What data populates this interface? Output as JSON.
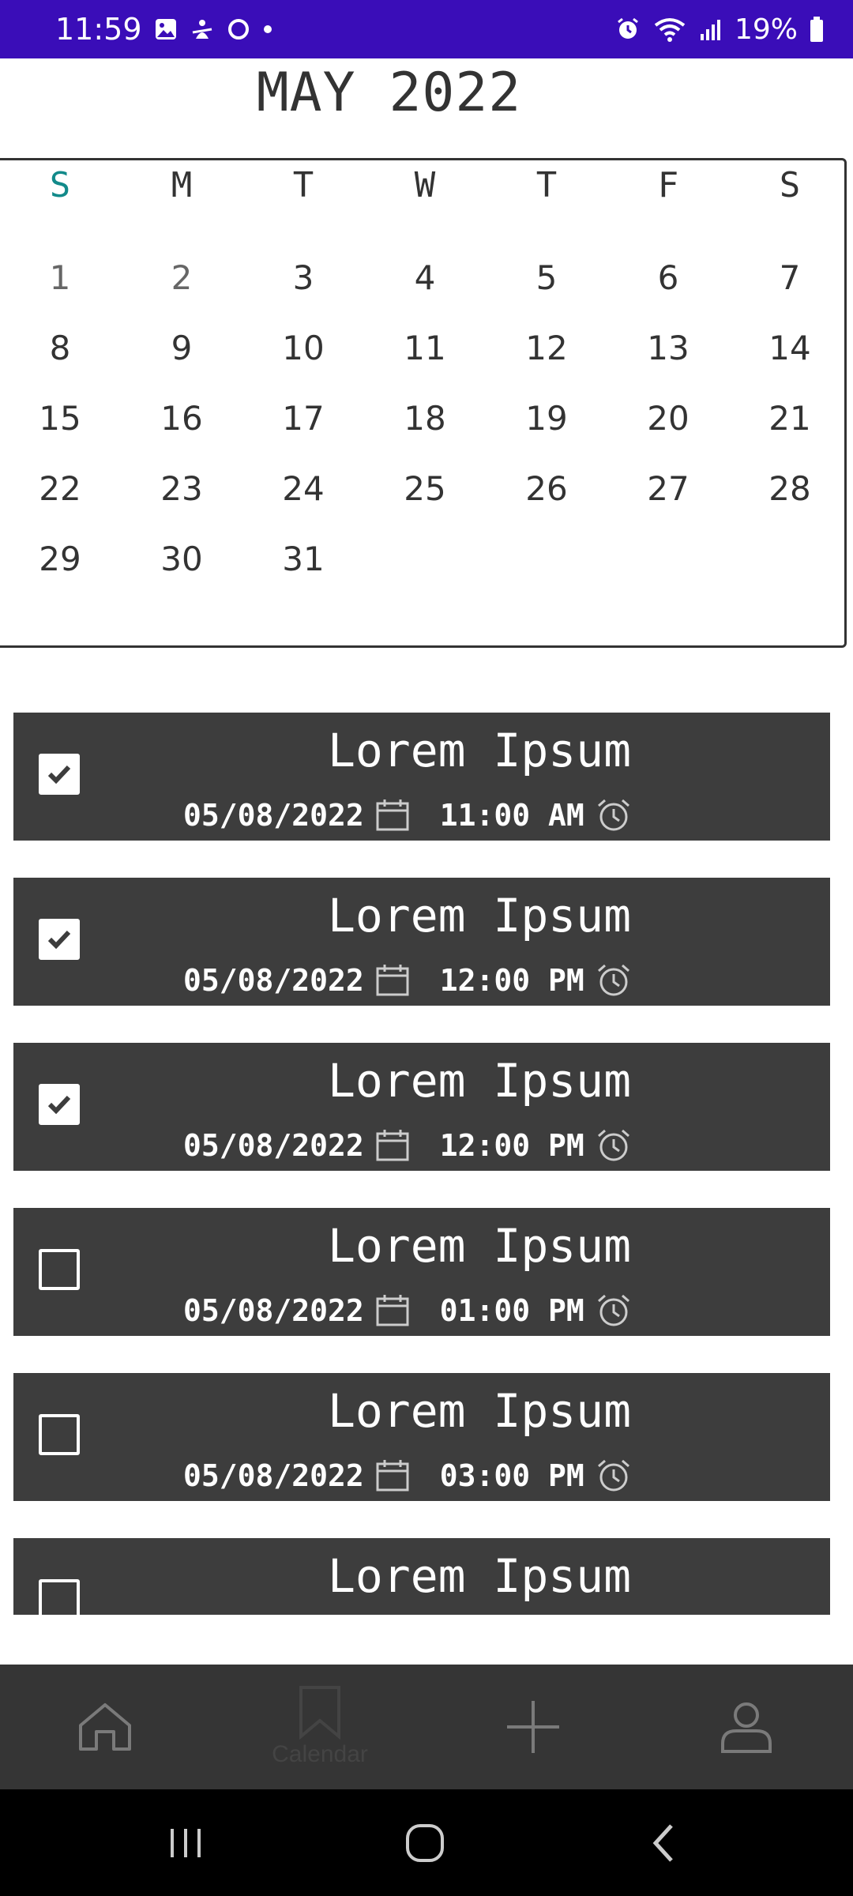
{
  "status_bar": {
    "time": "11:59",
    "battery": "19%",
    "background_color": "#3a0db8"
  },
  "calendar": {
    "month_title": "MAY 2022",
    "weekdays": [
      "S",
      "M",
      "T",
      "W",
      "T",
      "F",
      "S"
    ],
    "weeks": [
      [
        "",
        "1",
        "2",
        "3",
        "4",
        "5",
        "6",
        "7"
      ],
      [
        "8",
        "9",
        "10",
        "11",
        "12",
        "13",
        "14"
      ],
      [
        "15",
        "16",
        "17",
        "18",
        "19",
        "20",
        "21"
      ],
      [
        "22",
        "23",
        "24",
        "25",
        "26",
        "27",
        "28"
      ],
      [
        "29",
        "30",
        "31",
        "",
        "",
        "",
        ""
      ]
    ],
    "sunday_color": "#128a8a"
  },
  "tasks": [
    {
      "title": "Lorem Ipsum",
      "date": "05/08/2022",
      "time": "11:00 AM",
      "checked": true
    },
    {
      "title": "Lorem Ipsum",
      "date": "05/08/2022",
      "time": "12:00 PM",
      "checked": true
    },
    {
      "title": "Lorem Ipsum",
      "date": "05/08/2022",
      "time": "12:00 PM",
      "checked": true
    },
    {
      "title": "Lorem Ipsum",
      "date": "05/08/2022",
      "time": "01:00 PM",
      "checked": false
    },
    {
      "title": "Lorem Ipsum",
      "date": "05/08/2022",
      "time": "03:00 PM",
      "checked": false
    },
    {
      "title": "Lorem Ipsum",
      "checked": false
    }
  ],
  "bottom_nav": {
    "items": [
      {
        "icon": "home-icon"
      },
      {
        "icon": "bookmark-icon",
        "label": "Calendar"
      },
      {
        "icon": "plus-icon"
      },
      {
        "icon": "profile-icon"
      }
    ]
  },
  "system_nav": {
    "items": [
      "recents-icon",
      "home-circle-icon",
      "back-icon"
    ]
  }
}
